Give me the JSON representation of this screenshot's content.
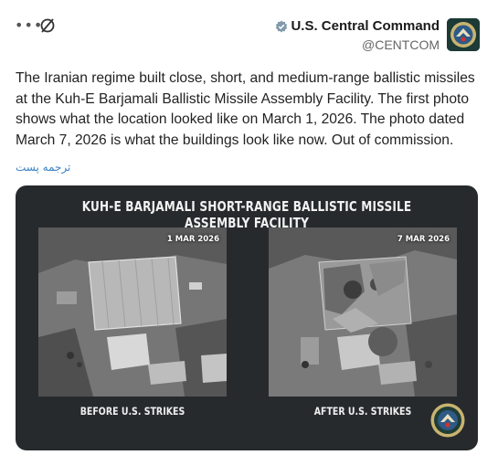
{
  "author": {
    "display_name": "U.S. Central Command",
    "handle": "@CENTCOM"
  },
  "tweet": {
    "text": "The Iranian regime built close, short, and medium-range ballistic missiles at the Kuh-E Barjamali Ballistic Missile Assembly Facility. The first photo shows what the location looked like on March 1, 2026. The photo dated March 7, 2026 is what the buildings look like now. Out of commission.",
    "translate_label": "ترجمه پست"
  },
  "media": {
    "title": "KUH-E BARJAMALI SHORT-RANGE BALLISTIC MISSILE ASSEMBLY FACILITY",
    "before": {
      "date": "1 MAR 2026",
      "caption": "BEFORE U.S. STRIKES"
    },
    "after": {
      "date": "7 MAR 2026",
      "caption": "AFTER U.S. STRIKES"
    }
  },
  "icons": {
    "more": "more-dots-icon",
    "grok": "grok-icon",
    "verified": "verified-badge-icon"
  },
  "colors": {
    "link": "#3b82c4",
    "verified_badge": "#829aab",
    "card_background": "#262a2c"
  }
}
